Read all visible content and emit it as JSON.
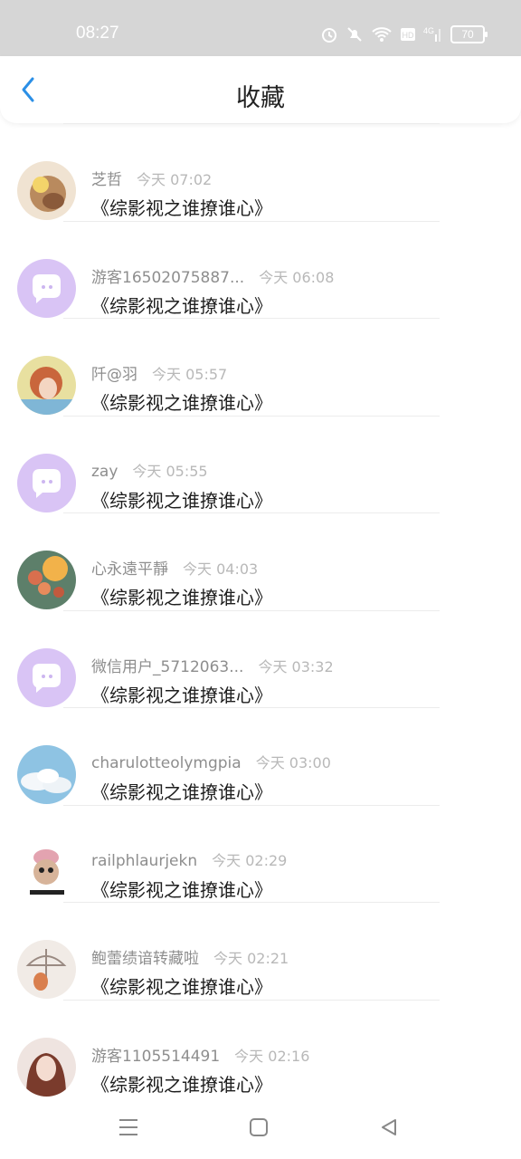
{
  "status": {
    "time": "08:27",
    "battery": "70"
  },
  "header": {
    "title": "收藏"
  },
  "items": [
    {
      "user": "芝哲",
      "time": "今天 07:02",
      "book": "《综影视之谁撩谁心》",
      "avatar": "a1"
    },
    {
      "user": "游客16502075887...",
      "time": "今天 06:08",
      "book": "《综影视之谁撩谁心》",
      "avatar": "default"
    },
    {
      "user": "阡@羽",
      "time": "今天 05:57",
      "book": "《综影视之谁撩谁心》",
      "avatar": "a3"
    },
    {
      "user": "zay",
      "time": "今天 05:55",
      "book": "《综影视之谁撩谁心》",
      "avatar": "default"
    },
    {
      "user": "心永遠平靜",
      "time": "今天 04:03",
      "book": "《综影视之谁撩谁心》",
      "avatar": "a5"
    },
    {
      "user": "微信用户_5712063...",
      "time": "今天 03:32",
      "book": "《综影视之谁撩谁心》",
      "avatar": "default"
    },
    {
      "user": "charulotteolymgpia",
      "time": "今天 03:00",
      "book": "《综影视之谁撩谁心》",
      "avatar": "a7"
    },
    {
      "user": "railphlaurjekn",
      "time": "今天 02:29",
      "book": "《综影视之谁撩谁心》",
      "avatar": "a8"
    },
    {
      "user": "鲍蕾绩谙转藏啦",
      "time": "今天 02:21",
      "book": "《综影视之谁撩谁心》",
      "avatar": "a9"
    },
    {
      "user": "游客1105514491",
      "time": "今天 02:16",
      "book": "《综影视之谁撩谁心》",
      "avatar": "a10"
    }
  ],
  "colors": {
    "accent": "#2b8fe6",
    "default_avatar": "#d9c4f5"
  }
}
